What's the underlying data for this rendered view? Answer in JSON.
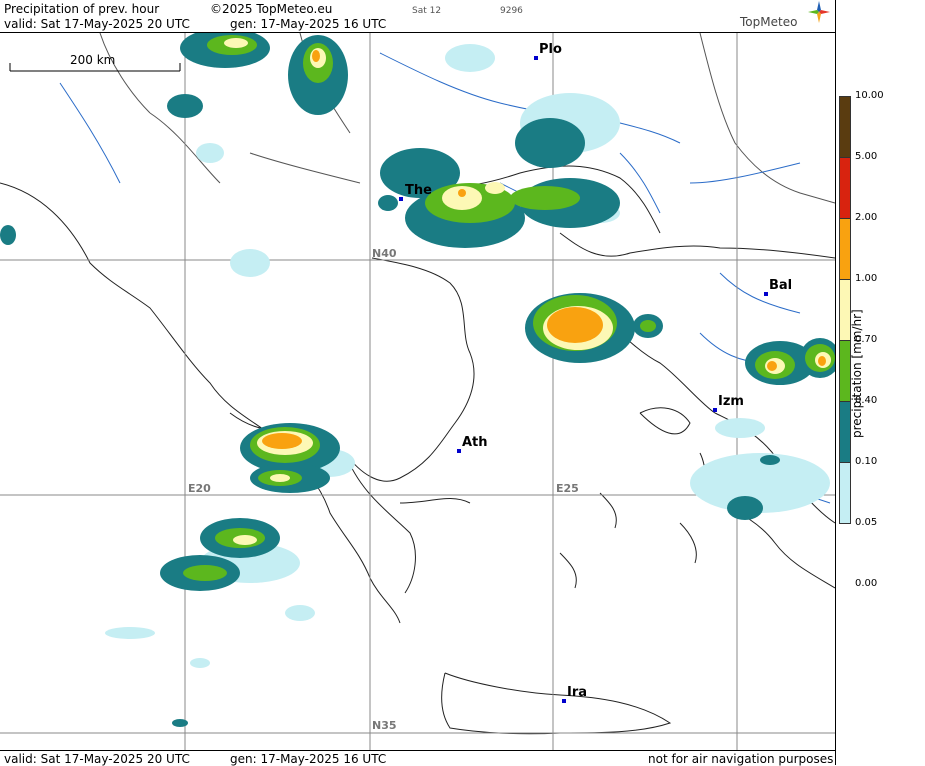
{
  "header": {
    "title": "Precipitation of prev. hour",
    "copyright": "©2025 TopMeteo.eu",
    "valid_line": "valid:  Sat  17-May-2025  20 UTC",
    "gen_line": "gen: 17-May-2025 16 UTC",
    "small1": "Sat 12",
    "small2": "9296",
    "logo": "TopMeteo"
  },
  "map": {
    "scale_label": "200 km",
    "grid_labels": {
      "n40": "N40",
      "n35": "N35",
      "e20": "E20",
      "e25": "E25"
    },
    "cities": [
      {
        "id": "plo",
        "name": "Plo"
      },
      {
        "id": "the",
        "name": "The"
      },
      {
        "id": "bal",
        "name": "Bal"
      },
      {
        "id": "izm",
        "name": "Izm"
      },
      {
        "id": "ath",
        "name": "Ath"
      },
      {
        "id": "ira",
        "name": "Ira"
      }
    ]
  },
  "footer": {
    "valid_line": "valid:  Sat  17-May-2025  20 UTC",
    "gen_line": "gen: 17-May-2025 16 UTC",
    "notice": "not for air navigation purposes"
  },
  "legend": {
    "unit": "precipitation  [mm/hr]",
    "ticks": [
      "10.00",
      "5.00",
      "2.00",
      "1.00",
      "0.70",
      "0.40",
      "0.10",
      "0.05",
      "0.00"
    ],
    "colors": [
      "#5a3c10",
      "#d8230f",
      "#f9a210",
      "#fdf8b5",
      "#5cb71e",
      "#1a7c84",
      "#c5eef3"
    ]
  }
}
